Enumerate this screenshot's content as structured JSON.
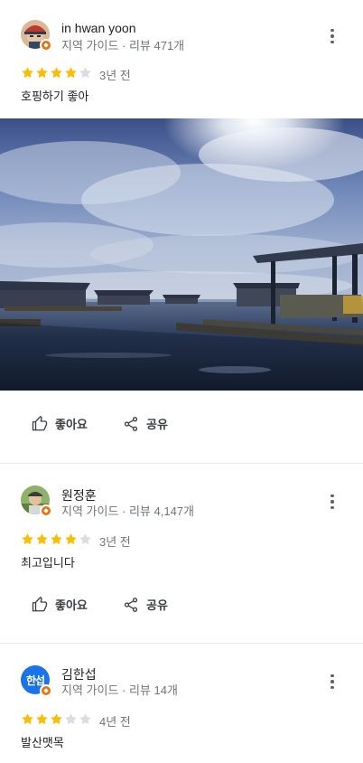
{
  "reviews": [
    {
      "name": "in hwan yoon",
      "meta": "지역 가이드 · 리뷰 471개",
      "rating": 4,
      "max_rating": 5,
      "time_ago": "3년 전",
      "text": "호핑하기 좋아",
      "has_photo": true,
      "avatar": "person-in-red-cap-photo"
    },
    {
      "name": "원정훈",
      "meta": "지역 가이드 · 리뷰 4,147개",
      "rating": 4,
      "max_rating": 5,
      "time_ago": "3년 전",
      "text": "최고입니다",
      "has_photo": false,
      "avatar": "person-outdoor-photo"
    },
    {
      "name": "김한섭",
      "meta": "지역 가이드 · 리뷰 14개",
      "rating": 3,
      "max_rating": 5,
      "time_ago": "4년 전",
      "text": "발산맷목",
      "has_photo": false,
      "avatar_initials": "한섭"
    }
  ],
  "actions": {
    "like_label": "좋아요",
    "share_label": "공유"
  },
  "colors": {
    "star_filled": "#fbbc04",
    "star_empty": "#dadce0",
    "local_guide_badge": "#e8710a",
    "initials_avatar_bg": "#1a73e8"
  },
  "icons": [
    "thumb-up-icon",
    "share-icon",
    "more-vert-icon",
    "star-icon",
    "local-guide-badge-icon"
  ]
}
